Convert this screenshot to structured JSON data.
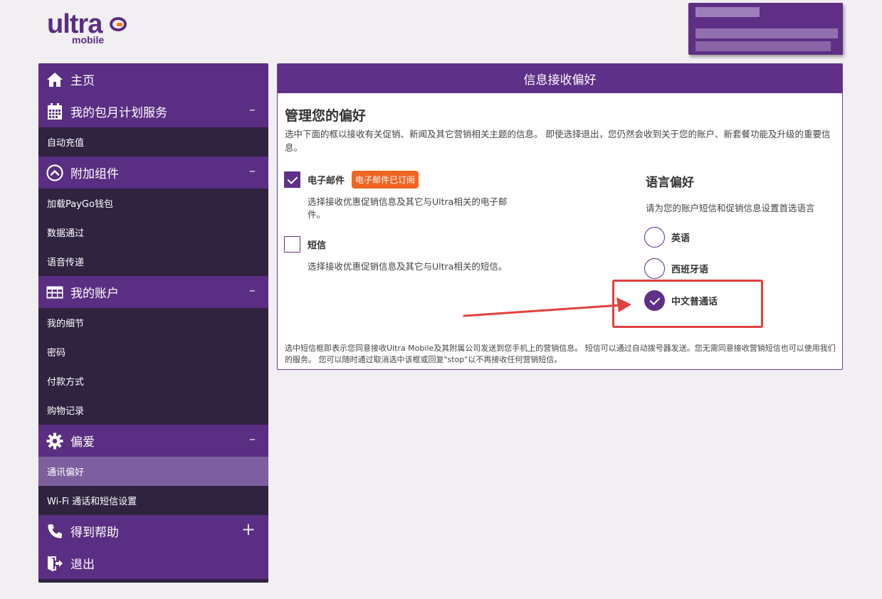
{
  "logo": {
    "word": "ultra",
    "sub": "mobile"
  },
  "sidebar": {
    "sections": [
      {
        "label": "主页",
        "icon": "home-icon",
        "toggle": ""
      },
      {
        "label": "我的包月计划服务",
        "icon": "calendar-icon",
        "toggle": "–"
      },
      {
        "label": "附加组件",
        "icon": "chevron-up-circle-icon",
        "toggle": "–"
      },
      {
        "label": "我的账户",
        "icon": "table-icon",
        "toggle": "–"
      },
      {
        "label": "偏爱",
        "icon": "gear-icon",
        "toggle": "–"
      },
      {
        "label": "得到帮助",
        "icon": "phone-icon",
        "toggle": "+"
      },
      {
        "label": "退出",
        "icon": "exit-icon",
        "toggle": ""
      }
    ],
    "plan_items": [
      "自动充值"
    ],
    "addon_items": [
      "加载PayGo钱包",
      "数据通过",
      "语音传递"
    ],
    "account_items": [
      "我的细节",
      "密码",
      "付款方式",
      "购物记录"
    ],
    "pref_items": [
      "通讯偏好",
      "Wi-Fi 通话和短信设置"
    ]
  },
  "panel": {
    "title": "信息接收偏好",
    "heading": "管理您的偏好",
    "intro": "选中下面的框以接收有关促销、新闻及其它营销相关主题的信息。 即使选择退出，您仍然会收到关于您的账户、新套餐功能及升级的重要信息。",
    "email": {
      "label": "电子邮件",
      "badge": "电子邮件已订阅",
      "desc": "选择接收优惠促销信息及其它与Ultra相关的电子邮件。",
      "checked": true
    },
    "sms": {
      "label": "短信",
      "desc": "选择接收优惠促销信息及其它与Ultra相关的短信。",
      "checked": false
    },
    "language": {
      "title": "语言偏好",
      "subtitle": "请为您的账户短信和促销信息设置首选语言",
      "options": [
        "英语",
        "西班牙语",
        "中文普通话"
      ],
      "selected": "中文普通话"
    },
    "footnote": "选中短信框即表示您同意接收Ultra Mobile及其附属公司发送到您手机上的营销信息。 短信可以通过自动拨号器发送。您无需同意接收营销短信也可以使用我们的服务。 您可以随时通过取消选中该框或回复\"stop\"以不再接收任何营销短信。"
  },
  "colors": {
    "brand_purple": "#5e3087",
    "sidebar_dark": "#2f2340",
    "active_item": "#7d5e9e",
    "badge_orange": "#f26522",
    "annotation_red": "#e0413f"
  }
}
